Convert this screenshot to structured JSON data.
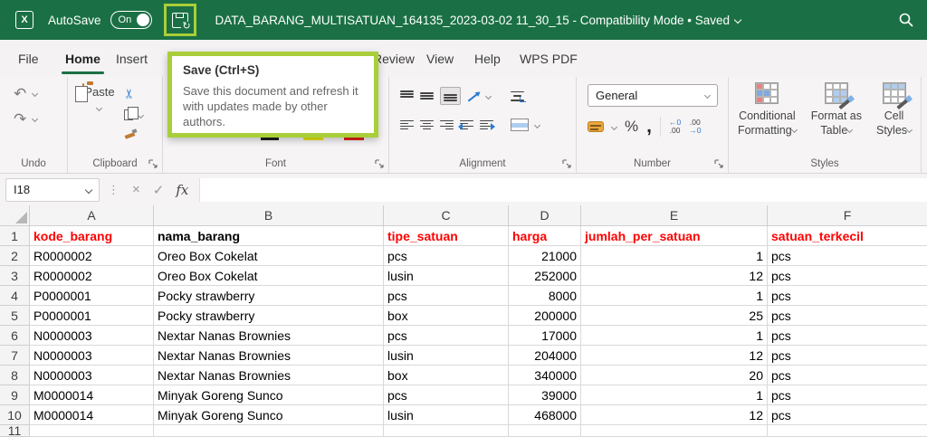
{
  "colors": {
    "titlebar_green": "#1A7044",
    "highlight_lime": "#A9CE3A",
    "header_red": "#FF0000"
  },
  "icons": {
    "undo": "↶",
    "redo": "↷",
    "cut": "✂",
    "refresh": "↻",
    "cancel": "×",
    "enter": "✓"
  },
  "titlebar": {
    "autosave_label": "AutoSave",
    "autosave_state": "On",
    "title": "DATA_BARANG_MULTISATUAN_164135_2023-03-02 11_30_15  -  Compatibility Mode • Saved"
  },
  "tabs": [
    "File",
    "Home",
    "Insert",
    "Review",
    "View",
    "Help",
    "WPS PDF"
  ],
  "tooltip": {
    "title": "Save (Ctrl+S)",
    "body": "Save this document and refresh it with updates made by other authors."
  },
  "ribbon": {
    "undo": {
      "label": "Undo"
    },
    "clipboard": {
      "label": "Clipboard",
      "paste": "Paste"
    },
    "font": {
      "label": "Font"
    },
    "alignment": {
      "label": "Alignment"
    },
    "number": {
      "label": "Number",
      "format": "General",
      "percent_icon": "%",
      "comma_icon": ",",
      "inc_decimal_top": "←0",
      "inc_decimal_bottom": ".00",
      "dec_decimal_top": ".00",
      "dec_decimal_bottom": "→0"
    },
    "styles": {
      "label": "Styles",
      "buttons": [
        {
          "line1": "Conditional",
          "line2": "Formatting"
        },
        {
          "line1": "Format as",
          "line2": "Table"
        },
        {
          "line1": "Cell",
          "line2": "Styles"
        }
      ]
    }
  },
  "formula_bar": {
    "name_box": "I18",
    "fx_label": "fx"
  },
  "sheet": {
    "columns": [
      "A",
      "B",
      "C",
      "D",
      "E",
      "F"
    ],
    "header_row": {
      "num": "1",
      "cells": [
        "kode_barang",
        "nama_barang",
        "tipe_satuan",
        "harga",
        "jumlah_per_satuan",
        "satuan_terkecil"
      ]
    },
    "rows": [
      {
        "num": "2",
        "cells": [
          "R0000002",
          "Oreo Box Cokelat",
          "pcs",
          "21000",
          "1",
          "pcs"
        ]
      },
      {
        "num": "3",
        "cells": [
          "R0000002",
          "Oreo Box Cokelat",
          "lusin",
          "252000",
          "12",
          "pcs"
        ]
      },
      {
        "num": "4",
        "cells": [
          "P0000001",
          "Pocky strawberry",
          "pcs",
          "8000",
          "1",
          "pcs"
        ]
      },
      {
        "num": "5",
        "cells": [
          "P0000001",
          "Pocky strawberry",
          "box",
          "200000",
          "25",
          "pcs"
        ]
      },
      {
        "num": "6",
        "cells": [
          "N0000003",
          "Nextar Nanas Brownies",
          "pcs",
          "17000",
          "1",
          "pcs"
        ]
      },
      {
        "num": "7",
        "cells": [
          "N0000003",
          "Nextar Nanas Brownies",
          "lusin",
          "204000",
          "12",
          "pcs"
        ]
      },
      {
        "num": "8",
        "cells": [
          "N0000003",
          "Nextar Nanas Brownies",
          "box",
          "340000",
          "20",
          "pcs"
        ]
      },
      {
        "num": "9",
        "cells": [
          "M0000014",
          "Minyak Goreng Sunco",
          "pcs",
          "39000",
          "1",
          "pcs"
        ]
      },
      {
        "num": "10",
        "cells": [
          "M0000014",
          "Minyak Goreng Sunco",
          "lusin",
          "468000",
          "12",
          "pcs"
        ]
      }
    ],
    "partial_row_num": "11"
  }
}
